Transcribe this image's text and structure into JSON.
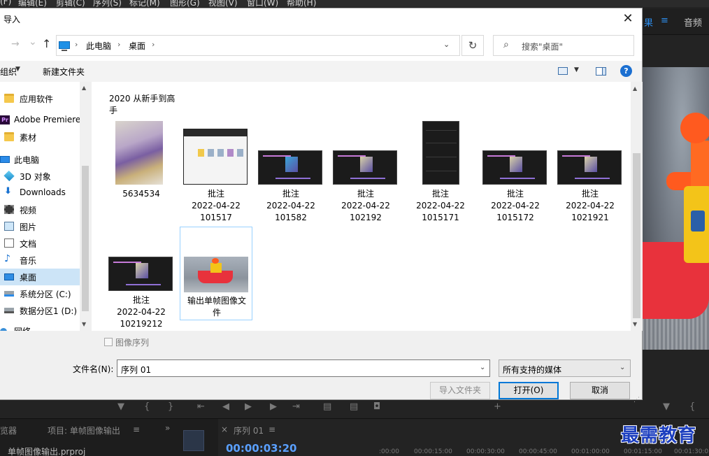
{
  "app": {
    "menu": [
      "(F)",
      "编辑(E)",
      "剪辑(C)",
      "序列(S)",
      "标记(M)",
      "图形(G)",
      "视图(V)",
      "窗口(W)",
      "帮助(H)"
    ],
    "right_tabs": {
      "effects": "果",
      "effects_menu": "≡",
      "audio": "音频"
    },
    "bottom": {
      "panel_browser": "览器",
      "panel_project": "项目: 单帧图像输出",
      "panel_project_menu": "≡",
      "project_file": "单帧图像输出.prproj",
      "seq_close": "×",
      "seq_tab": "序列 01",
      "seq_tab_menu": "≡",
      "timecode": "00:00:03:20",
      "ruler": [
        ":00:00",
        "00:00:15:00",
        "00:00:30:00",
        "00:00:45:00",
        "00:01:00:00",
        "00:01:15:00",
        "00:01:30:0"
      ]
    },
    "watermark": "最需教育"
  },
  "dialog": {
    "title": "导入",
    "close_glyph": "✕",
    "nav": {
      "back": "→",
      "forward_caret": "⌄",
      "up": "↑",
      "breadcrumbs": [
        "此电脑",
        "桌面"
      ],
      "crumb_sep": "›",
      "dropdown": "⌄",
      "refresh": "↻",
      "search_placeholder": "搜索\"桌面\"",
      "search_glyph": "⌕"
    },
    "toolbar": {
      "organize": "组织",
      "organize_caret": "▼",
      "new_folder": "新建文件夹",
      "view_caret": "▼",
      "help": "?"
    },
    "nav_pane": [
      {
        "label": "应用软件",
        "icon": "folder-icon",
        "kind": "folder"
      },
      {
        "label": "Adobe Premiere",
        "icon": "premiere-icon",
        "kind": "pr",
        "glyph": "Pr"
      },
      {
        "label": "素材",
        "icon": "folder-icon",
        "kind": "folder"
      },
      {
        "label": "此电脑",
        "icon": "computer-icon",
        "kind": "pc"
      },
      {
        "label": "3D 对象",
        "icon": "cube-icon",
        "kind": "cube"
      },
      {
        "label": "Downloads",
        "icon": "download-icon",
        "kind": "down",
        "glyph": "⬇"
      },
      {
        "label": "视频",
        "icon": "video-icon",
        "kind": "video"
      },
      {
        "label": "图片",
        "icon": "pictures-icon",
        "kind": "pics"
      },
      {
        "label": "文档",
        "icon": "documents-icon",
        "kind": "docs"
      },
      {
        "label": "音乐",
        "icon": "music-icon",
        "kind": "music",
        "glyph": "♪"
      },
      {
        "label": "桌面",
        "icon": "desktop-icon",
        "kind": "desk",
        "selected": true
      },
      {
        "label": "系统分区 (C:)",
        "icon": "drive-c-icon",
        "kind": "drivec"
      },
      {
        "label": "数据分区1 (D:)",
        "icon": "drive-d-icon",
        "kind": "drived"
      },
      {
        "label": "网络",
        "icon": "network-icon",
        "kind": "net"
      }
    ],
    "files": [
      {
        "name": "2020 从新手到高\n手",
        "kind": "folder-label"
      },
      {
        "name": "5634534",
        "kind": "photo"
      },
      {
        "name": "批注\n2022-04-22\n101517",
        "kind": "shot-light"
      },
      {
        "name": "批注\n2022-04-22\n101582",
        "kind": "shot"
      },
      {
        "name": "批注\n2022-04-22\n102192",
        "kind": "shot"
      },
      {
        "name": "批注\n2022-04-22\n1015171",
        "kind": "shot-tall"
      },
      {
        "name": "批注\n2022-04-22\n1015172",
        "kind": "shot"
      },
      {
        "name": "批注\n2022-04-22\n1021921",
        "kind": "shot"
      },
      {
        "name": "批注\n2022-04-22\n10219212",
        "kind": "shot"
      },
      {
        "name": "输出单帧图像文\n件",
        "kind": "boat",
        "selected": true
      }
    ],
    "image_sequence_label": "图像序列",
    "filename_label": "文件名(N):",
    "filename_value": "序列 01",
    "filetype_value": "所有支持的媒体",
    "caret": "⌄",
    "buttons": {
      "import_folder": "导入文件夹",
      "open": "打开(O)",
      "cancel": "取消"
    },
    "scroll_up": "▲",
    "scroll_down": "▼"
  }
}
